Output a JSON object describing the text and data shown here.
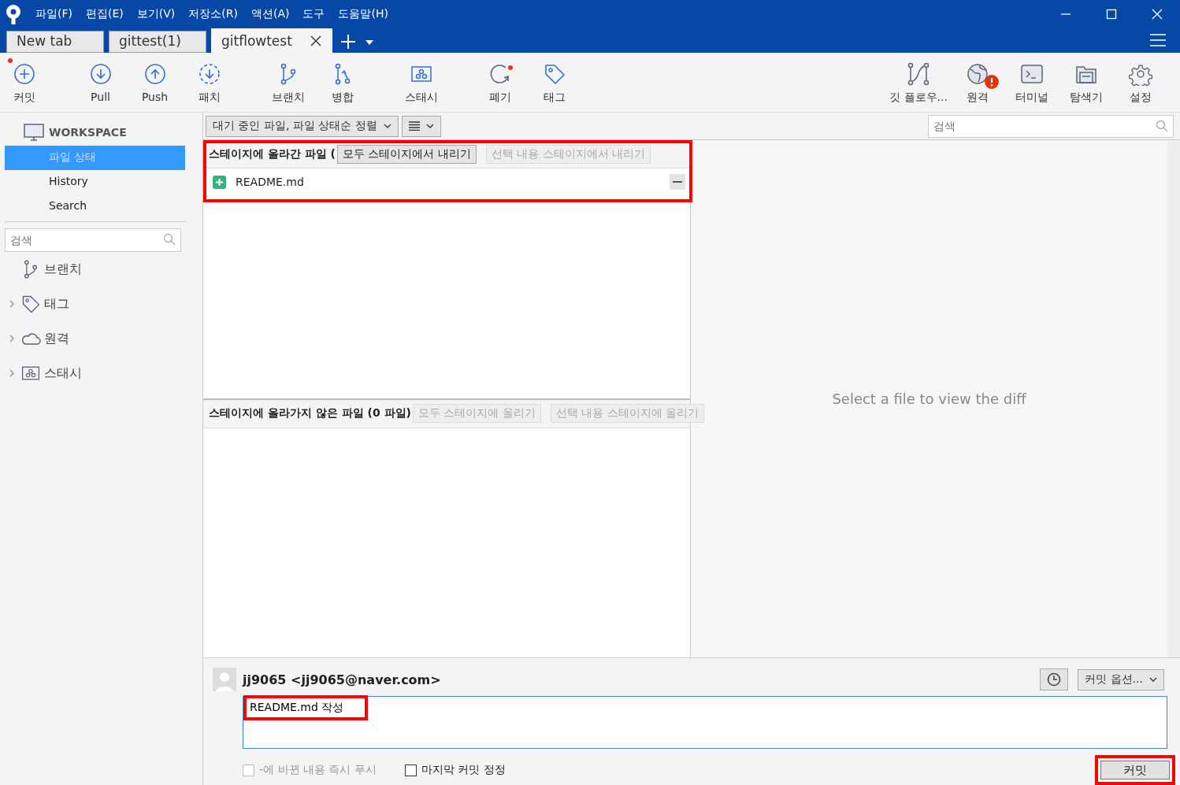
{
  "menu": [
    "파일(F)",
    "편집(E)",
    "보기(V)",
    "저장소(R)",
    "액션(A)",
    "도구",
    "도움말(H)"
  ],
  "tabs": [
    {
      "label": "New tab",
      "selected": false
    },
    {
      "label": "gittest(1)",
      "selected": false
    },
    {
      "label": "gitflowtest",
      "selected": true
    }
  ],
  "toolbar_left": [
    [
      {
        "kind": "commit",
        "label": "커밋",
        "notification": true
      }
    ],
    [
      {
        "kind": "pull",
        "label": "Pull"
      },
      {
        "kind": "push",
        "label": "Push"
      },
      {
        "kind": "patch",
        "label": "패치"
      }
    ],
    [
      {
        "kind": "branch",
        "label": "브랜치"
      },
      {
        "kind": "merge",
        "label": "병합"
      }
    ],
    [
      {
        "kind": "stash",
        "label": "스태시"
      }
    ],
    [
      {
        "kind": "discard",
        "label": "폐기",
        "notification": true
      },
      {
        "kind": "tag",
        "label": "태그"
      }
    ]
  ],
  "toolbar_right": [
    {
      "kind": "gitflow",
      "label": "깃 플로우..."
    },
    {
      "kind": "remote",
      "label": "원격",
      "alert": true
    },
    {
      "kind": "terminal",
      "label": "터미널"
    },
    {
      "kind": "explorer",
      "label": "탐색기"
    },
    {
      "kind": "settings",
      "label": "설정"
    }
  ],
  "sidebar": {
    "workspace": "WORKSPACE",
    "items": [
      {
        "label": "파일 상태",
        "selected": true
      },
      {
        "label": "History",
        "selected": false
      },
      {
        "label": "Search",
        "selected": false
      }
    ],
    "search_placeholder": "검색",
    "sections": [
      {
        "kind": "branch",
        "label": "브랜치",
        "expandable": false
      },
      {
        "kind": "tag",
        "label": "태그",
        "expandable": true
      },
      {
        "kind": "remote",
        "label": "원격",
        "expandable": true
      },
      {
        "kind": "stash",
        "label": "스태시",
        "expandable": true
      }
    ]
  },
  "filter": {
    "sort": "대기 중인 파일, 파일 상태순 정렬",
    "search_placeholder": "검색"
  },
  "staged": {
    "title": "스테이지에 올라간 파일 (",
    "highlighted": true,
    "buttons": [
      {
        "label": "모두 스테이지에서 내리기",
        "disabled": false
      },
      {
        "label": "선택 내용 스테이지에서 내리기",
        "disabled": true
      }
    ],
    "files": [
      {
        "name": "README.md",
        "added": true
      }
    ]
  },
  "unstaged": {
    "title": "스테이지에 올라가지 않은 파일 (0 파일)",
    "buttons": [
      {
        "label": "모두 스테이지에 올리기",
        "disabled": true
      },
      {
        "label": "선택 내용 스테이지에 올리기",
        "disabled": true
      }
    ]
  },
  "diff_placeholder": "Select a file to view the diff",
  "commit": {
    "author": "jj9065 <jj9065@naver.com>",
    "options": "커밋 옵션...",
    "message": "README.md 작성",
    "message_highlighted": true,
    "checkboxes": [
      {
        "label": "-에 바뀐 내용 즉시 푸시",
        "checked": false,
        "disabled": true
      },
      {
        "label": "마지막 커밋 정정",
        "checked": false,
        "disabled": false
      }
    ],
    "button": "커밋",
    "button_highlighted": true
  }
}
